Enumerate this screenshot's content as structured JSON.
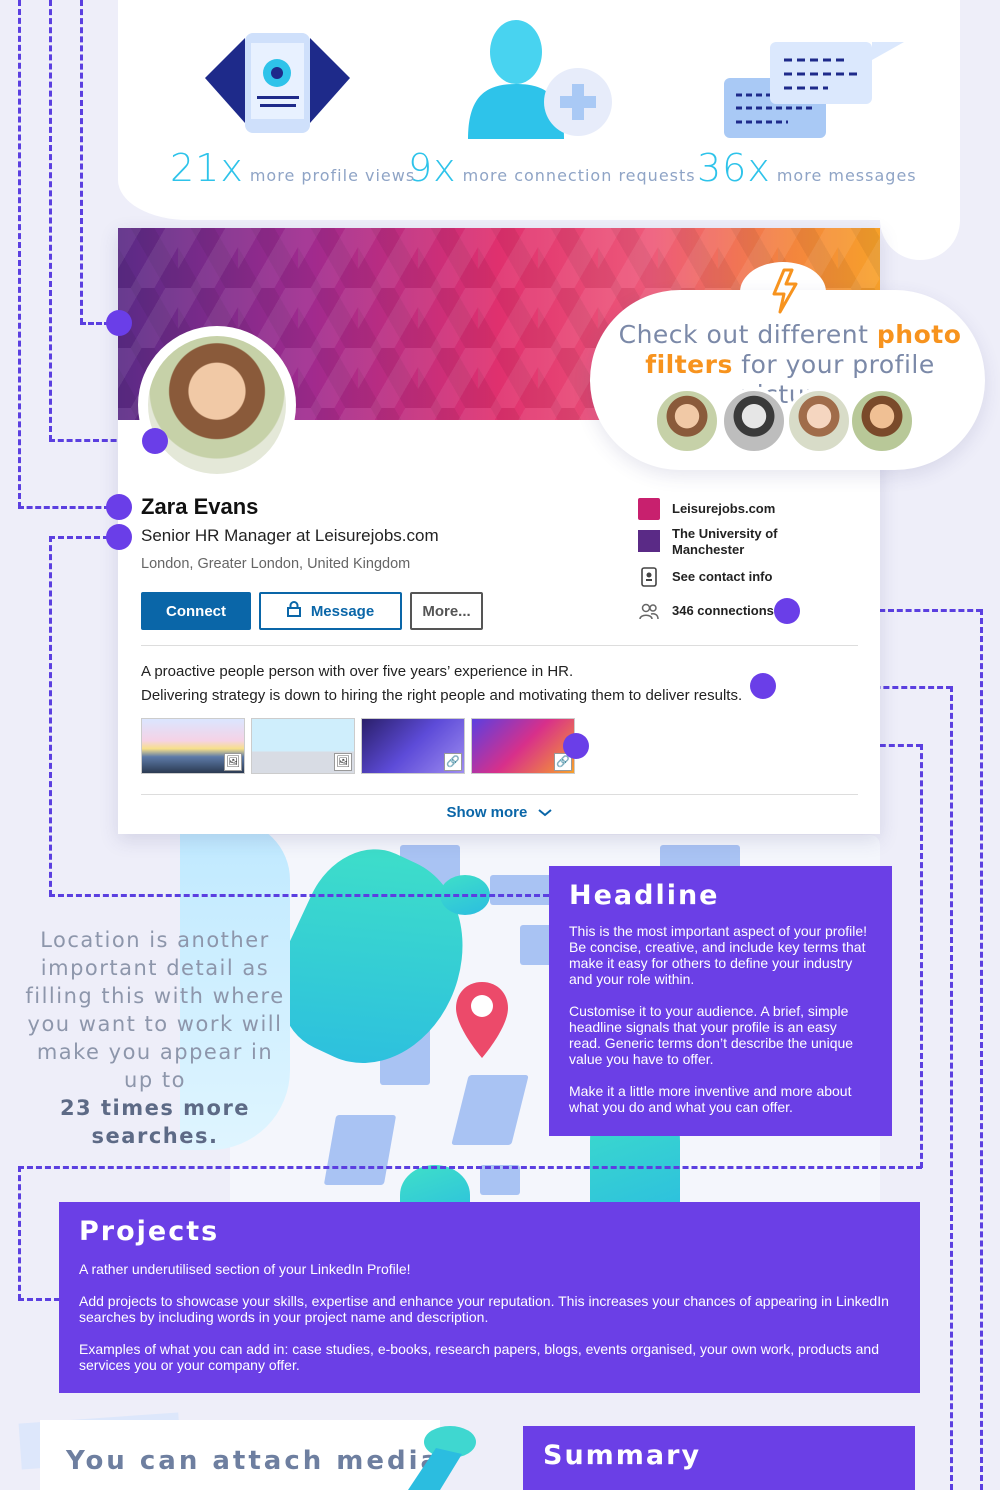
{
  "stats": [
    {
      "value": "21x",
      "label": "more profile views"
    },
    {
      "value": "9x",
      "label": "more connection requests"
    },
    {
      "value": "36x",
      "label": "more messages"
    }
  ],
  "profile": {
    "name": "Zara Evans",
    "headline": "Senior HR Manager at Leisurejobs.com",
    "location": "London, Greater London, United Kingdom",
    "buttons": {
      "connect": "Connect",
      "message": "Message",
      "more": "More..."
    },
    "side": {
      "company": "Leisurejobs.com",
      "school": "The University of Manchester",
      "contact": "See contact info",
      "connections": "346 connections"
    },
    "summary_line1": "A proactive people person with over five years’ experience in HR.",
    "summary_line2": "Delivering strategy is down to hiring the right people and motivating them to deliver results.",
    "show_more": "Show more"
  },
  "filters_bubble": {
    "part1": "Check out different ",
    "highlight1": "photo",
    "highlight2": "filters",
    "part2": " for your profile picture."
  },
  "location_text": {
    "body": "Location is another important detail as filling this with where you want to work will make you appear in up to",
    "emphasis": "23 times more",
    "tail": "searches."
  },
  "headline_box": {
    "title": "Headline",
    "p1": "This is the most important aspect of your profile! Be concise, creative, and include key terms that make it easy for others to define your industry and your role within.",
    "p2": "Customise it to your audience. A brief, simple headline signals that your profile is an easy read. Generic terms don’t describe the unique value you have to offer.",
    "p3": "Make it a little more inventive and more about what you do and what you can offer."
  },
  "projects_box": {
    "title": "Projects",
    "p1": "A rather underutilised section of your LinkedIn Profile!",
    "p2": "Add projects to showcase your skills, expertise and enhance your reputation. This increases your chances of appearing in LinkedIn searches by including words in your project name and description.",
    "p3": "Examples of what you can add in: case studies, e-books, research papers, blogs, events organised, your own work, products and services you or your company offer."
  },
  "summary_box": {
    "title": "Summary"
  },
  "attach_text": "You can attach media",
  "thumb_badges": [
    "🖼",
    "🖼",
    "🔗",
    "🔗"
  ]
}
